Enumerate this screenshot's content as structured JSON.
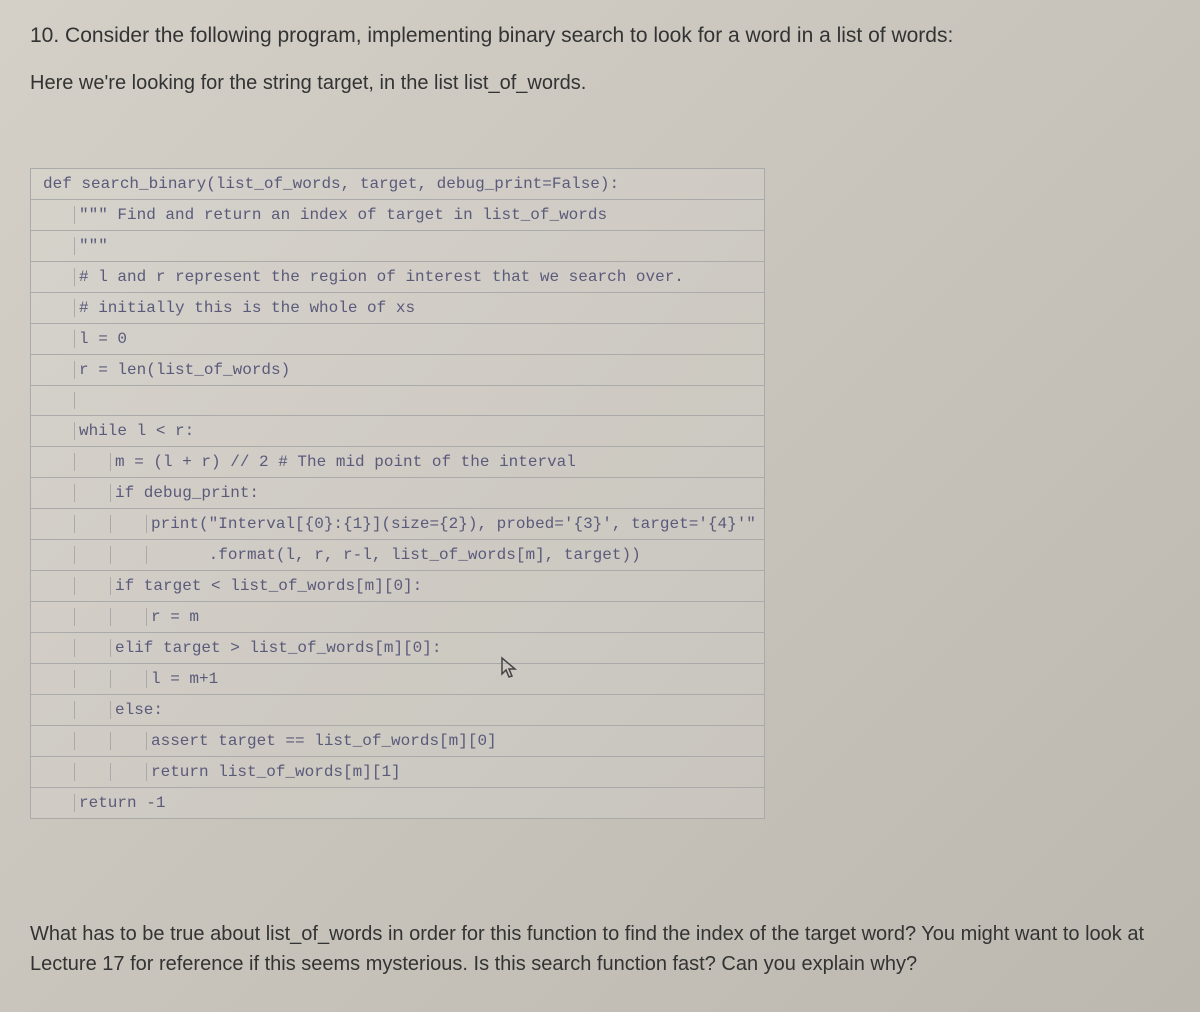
{
  "question_number": "10.",
  "question_intro": "Consider the following program, implementing binary search to look for a word in a list of words:",
  "question_sub": "Here we're looking for the string target, in the list list_of_words.",
  "code": {
    "lines": [
      {
        "indent": 0,
        "text": "def search_binary(list_of_words, target, debug_print=False):"
      },
      {
        "indent": 1,
        "text": "\"\"\" Find and return an index of target in list_of_words"
      },
      {
        "indent": 1,
        "text": "\"\"\""
      },
      {
        "indent": 1,
        "text": "# l and r represent the region of interest that we search over."
      },
      {
        "indent": 1,
        "text": "# initially this is the whole of xs"
      },
      {
        "indent": 1,
        "text": "l = 0"
      },
      {
        "indent": 1,
        "text": "r = len(list_of_words)"
      },
      {
        "indent": 1,
        "text": ""
      },
      {
        "indent": 1,
        "text": "while l < r:"
      },
      {
        "indent": 2,
        "text": "m = (l + r) // 2 # The mid point of the interval"
      },
      {
        "indent": 2,
        "text": "if debug_print:"
      },
      {
        "indent": 3,
        "text": "print(\"Interval[{0}:{1}](size={2}), probed='{3}', target='{4}'\""
      },
      {
        "indent": 3,
        "text": "      .format(l, r, r-l, list_of_words[m], target))"
      },
      {
        "indent": 2,
        "text": "if target < list_of_words[m][0]:"
      },
      {
        "indent": 3,
        "text": "r = m"
      },
      {
        "indent": 2,
        "text": "elif target > list_of_words[m][0]:"
      },
      {
        "indent": 3,
        "text": "l = m+1"
      },
      {
        "indent": 2,
        "text": "else:"
      },
      {
        "indent": 3,
        "text": "assert target == list_of_words[m][0]"
      },
      {
        "indent": 3,
        "text": "return list_of_words[m][1]"
      },
      {
        "indent": 1,
        "text": "return -1"
      }
    ]
  },
  "question_footer": "What has to be true about list_of_words in order for this function to find the index of the target word? You might want to look at Lecture 17 for reference if this seems mysterious. Is this search function fast? Can you explain why?"
}
